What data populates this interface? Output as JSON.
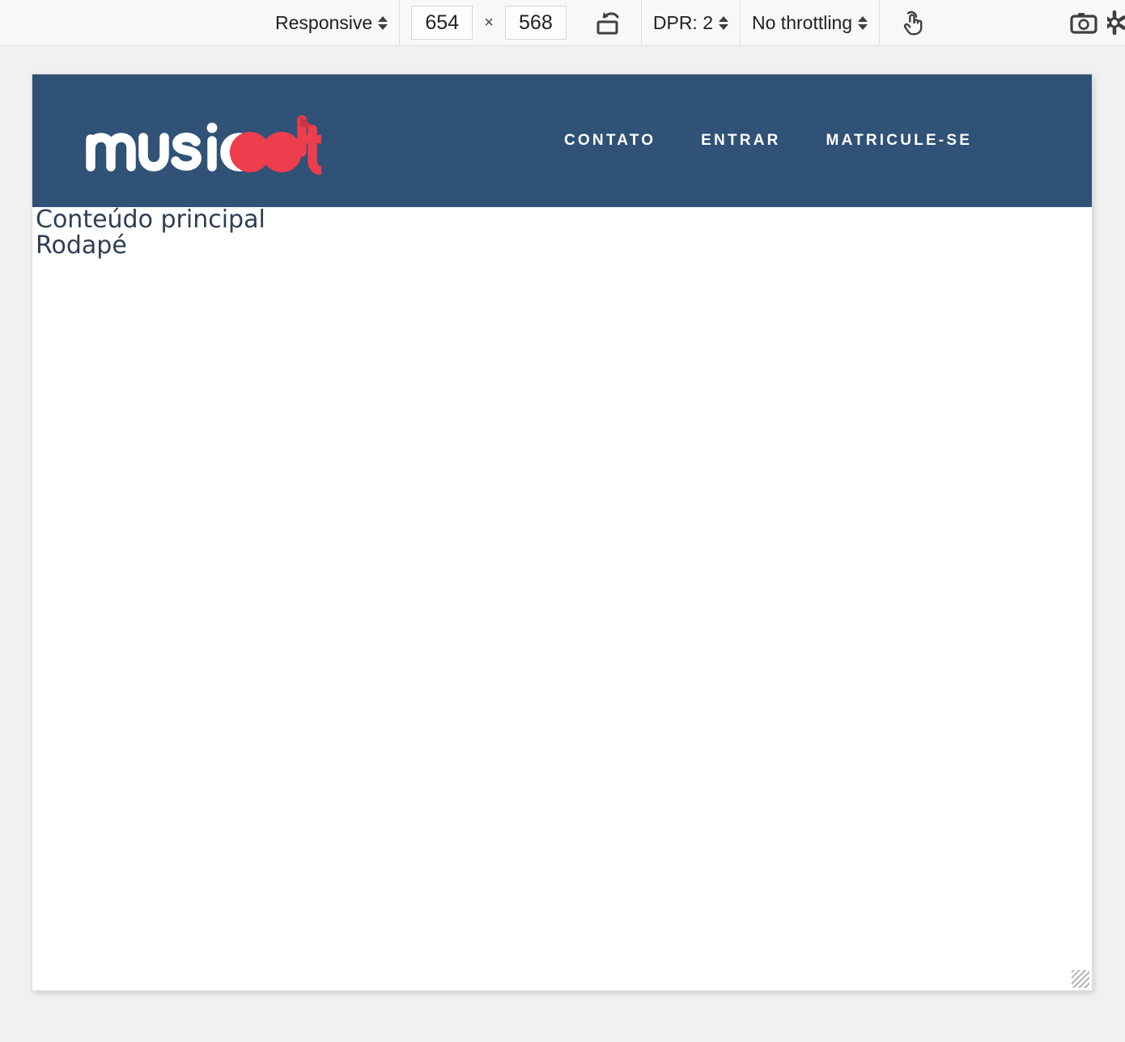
{
  "devtools_toolbar": {
    "device_preset": {
      "label": "Responsive",
      "icon": "chevron-updown-icon"
    },
    "dimensions": {
      "width": "654",
      "separator": "×",
      "height": "568"
    },
    "rotate": {
      "icon": "rotate-device-icon",
      "title": "Rotate"
    },
    "dpr": {
      "label": "DPR: 2",
      "icon": "chevron-updown-icon"
    },
    "throttling": {
      "label": "No throttling",
      "icon": "chevron-updown-icon"
    },
    "touch_cursor": {
      "icon": "touch-pointer-icon",
      "title": "Touch"
    },
    "screenshot": {
      "icon": "camera-icon",
      "title": "Capture screenshot"
    },
    "more_options": {
      "icon": "more-options-icon",
      "title": "More options"
    }
  },
  "page": {
    "header": {
      "logo": {
        "text_primary": "music",
        "text_accent": "dot",
        "accent_color": "#ee3d4d",
        "primary_color": "#ffffff"
      },
      "background_color": "#2f5276",
      "nav": [
        {
          "label": "CONTATO"
        },
        {
          "label": "ENTRAR"
        },
        {
          "label": "MATRICULE-SE"
        }
      ]
    },
    "main": {
      "text": "Conteúdo principal"
    },
    "footer": {
      "text": "Rodapé"
    },
    "text_color": "#2e3f52"
  }
}
